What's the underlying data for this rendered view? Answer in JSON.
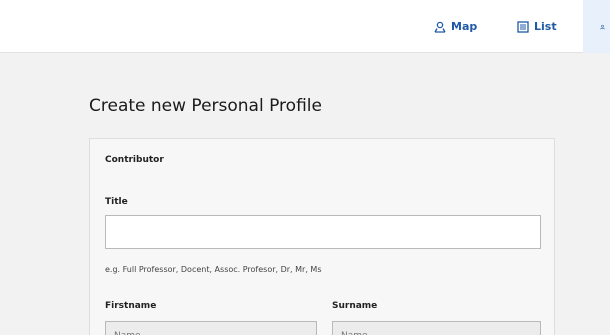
{
  "nav": {
    "items": [
      {
        "label": "Map",
        "icon": "map-pin-icon"
      },
      {
        "label": "List",
        "icon": "list-icon"
      },
      {
        "label": "",
        "icon": "user-icon"
      }
    ],
    "accent": "#1f5aa6"
  },
  "page": {
    "title": "Create new Personal Profile"
  },
  "form": {
    "section_title": "Contributor",
    "title_label": "Title",
    "title_value": "",
    "title_hint": "e.g. Full Professor, Docent, Assoc. Profesor, Dr, Mr, Ms",
    "firstname_label": "Firstname",
    "firstname_placeholder": "Name",
    "surname_label": "Surname",
    "surname_placeholder": "Name"
  }
}
